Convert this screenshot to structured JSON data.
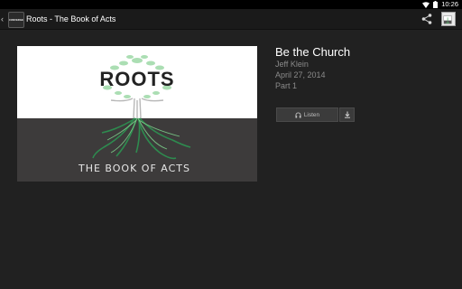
{
  "status_bar": {
    "time": "10:26"
  },
  "action_bar": {
    "back_glyph": "‹",
    "logo_text": "CONVERGE",
    "title": "Roots - The Book of Acts"
  },
  "artwork": {
    "headline": "ROOTS",
    "subline": "THE BOOK OF ACTS",
    "colors": {
      "top": "#ffffff",
      "bottom": "#3d3b3b",
      "leaf": "#7ccf8a",
      "root": "#2e8b4f"
    }
  },
  "sermon": {
    "title": "Be the Church",
    "speaker": "Jeff Klein",
    "date": "April 27, 2014",
    "part": "Part 1"
  },
  "actions": {
    "listen_label": "Listen",
    "listen_icon": "headphones-icon",
    "download_icon": "download-icon"
  }
}
